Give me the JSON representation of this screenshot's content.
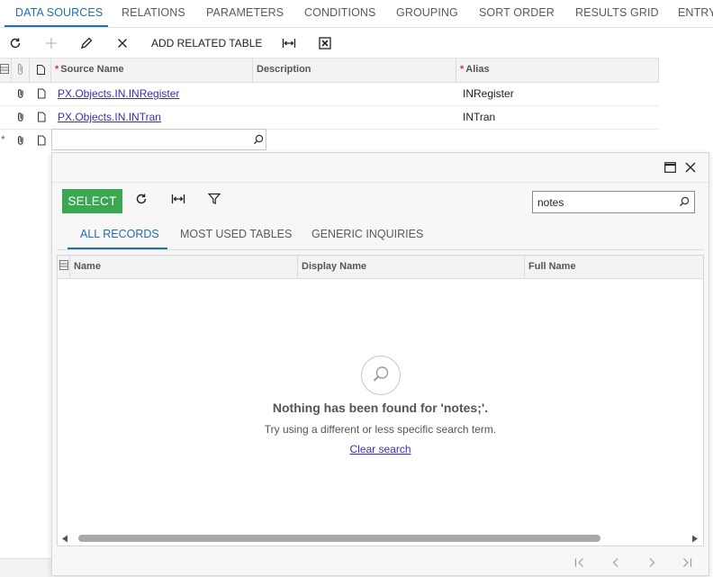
{
  "tabs": [
    "DATA SOURCES",
    "RELATIONS",
    "PARAMETERS",
    "CONDITIONS",
    "GROUPING",
    "SORT ORDER",
    "RESULTS GRID",
    "ENTRY"
  ],
  "toolbar": {
    "add_related_label": "ADD RELATED TABLE"
  },
  "grid": {
    "columns": {
      "source_name": "Source Name",
      "description": "Description",
      "alias": "Alias",
      "required_mark": "*"
    },
    "rows": [
      {
        "source_name": "PX.Objects.IN.INRegister",
        "description": "",
        "alias": "INRegister"
      },
      {
        "source_name": "PX.Objects.IN.INTran",
        "description": "",
        "alias": "INTran"
      }
    ],
    "new_row_mark": "*"
  },
  "dialog": {
    "select_label": "SELECT",
    "search_value": "notes",
    "subtabs": [
      "ALL RECORDS",
      "MOST USED TABLES",
      "GENERIC INQUIRIES"
    ],
    "columns": {
      "name": "Name",
      "display_name": "Display Name",
      "full_name": "Full Name"
    },
    "empty": {
      "title": "Nothing has been found for 'notes;'.",
      "subtitle": "Try using a different or less specific search term.",
      "clear_link": "Clear search"
    }
  },
  "colors": {
    "accent": "#1e6fb8",
    "select_button": "#3aa853",
    "link": "#3a2fb0",
    "required": "#d32f2f"
  }
}
